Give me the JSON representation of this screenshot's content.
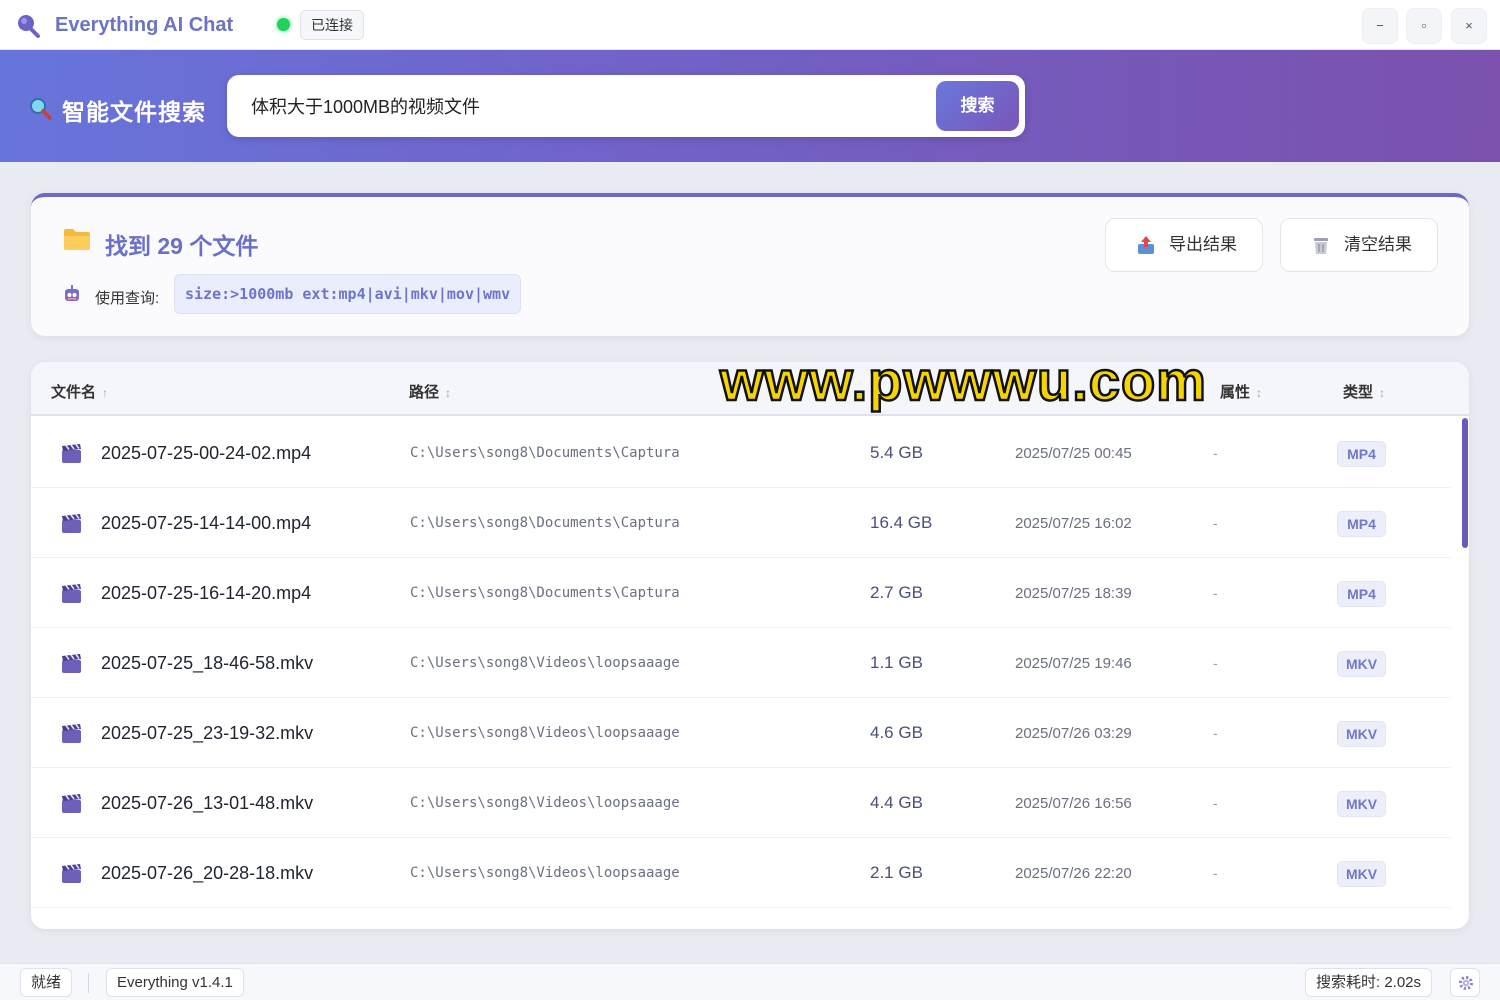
{
  "app": {
    "title": "Everything AI Chat",
    "connection_status": "已连接",
    "window_buttons": {
      "minimize": "−",
      "maximize": "▫",
      "close": "×"
    }
  },
  "header": {
    "title": "智能文件搜索",
    "search_value": "体积大于1000MB的视频文件",
    "search_button": "搜索"
  },
  "summary": {
    "title": "找到 29 个文件",
    "query_label": "使用查询:",
    "query": "size:>1000mb ext:mp4|avi|mkv|mov|wmv",
    "export_button": "导出结果",
    "clear_button": "清空结果"
  },
  "table": {
    "columns": {
      "name": "文件名",
      "name_sort": "↑",
      "path": "路径",
      "path_sort": "↕",
      "attr": "属性",
      "attr_sort": "↕",
      "type": "类型",
      "type_sort": "↕"
    },
    "rows": [
      {
        "name": "2025-07-25-00-24-02.mp4",
        "path": "C:\\Users\\song8\\Documents\\Captura",
        "size": "5.4 GB",
        "date": "2025/07/25 00:45",
        "attr": "-",
        "type": "MP4"
      },
      {
        "name": "2025-07-25-14-14-00.mp4",
        "path": "C:\\Users\\song8\\Documents\\Captura",
        "size": "16.4 GB",
        "date": "2025/07/25 16:02",
        "attr": "-",
        "type": "MP4"
      },
      {
        "name": "2025-07-25-16-14-20.mp4",
        "path": "C:\\Users\\song8\\Documents\\Captura",
        "size": "2.7 GB",
        "date": "2025/07/25 18:39",
        "attr": "-",
        "type": "MP4"
      },
      {
        "name": "2025-07-25_18-46-58.mkv",
        "path": "C:\\Users\\song8\\Videos\\loopsaaage",
        "size": "1.1 GB",
        "date": "2025/07/25 19:46",
        "attr": "-",
        "type": "MKV"
      },
      {
        "name": "2025-07-25_23-19-32.mkv",
        "path": "C:\\Users\\song8\\Videos\\loopsaaage",
        "size": "4.6 GB",
        "date": "2025/07/26 03:29",
        "attr": "-",
        "type": "MKV"
      },
      {
        "name": "2025-07-26_13-01-48.mkv",
        "path": "C:\\Users\\song8\\Videos\\loopsaaage",
        "size": "4.4 GB",
        "date": "2025/07/26 16:56",
        "attr": "-",
        "type": "MKV"
      },
      {
        "name": "2025-07-26_20-28-18.mkv",
        "path": "C:\\Users\\song8\\Videos\\loopsaaage",
        "size": "2.1 GB",
        "date": "2025/07/26 22:20",
        "attr": "-",
        "type": "MKV"
      }
    ]
  },
  "watermark": "www.pwwwu.com",
  "statusbar": {
    "ready": "就绪",
    "version": "Everything v1.4.1",
    "elapsed": "搜索耗时: 2.02s"
  },
  "colors": {
    "accent": "#6d67c6",
    "header_start": "#6775db",
    "header_end": "#7b51ad",
    "connected": "#1fd35a"
  },
  "icons": {
    "app_logo": "magnifier-icon",
    "header": "search-icon",
    "summary": "folder-icon",
    "query": "robot-icon",
    "export": "export-icon",
    "clear": "trash-icon",
    "file": "video-clapper-icon",
    "settings": "gear-icon"
  }
}
